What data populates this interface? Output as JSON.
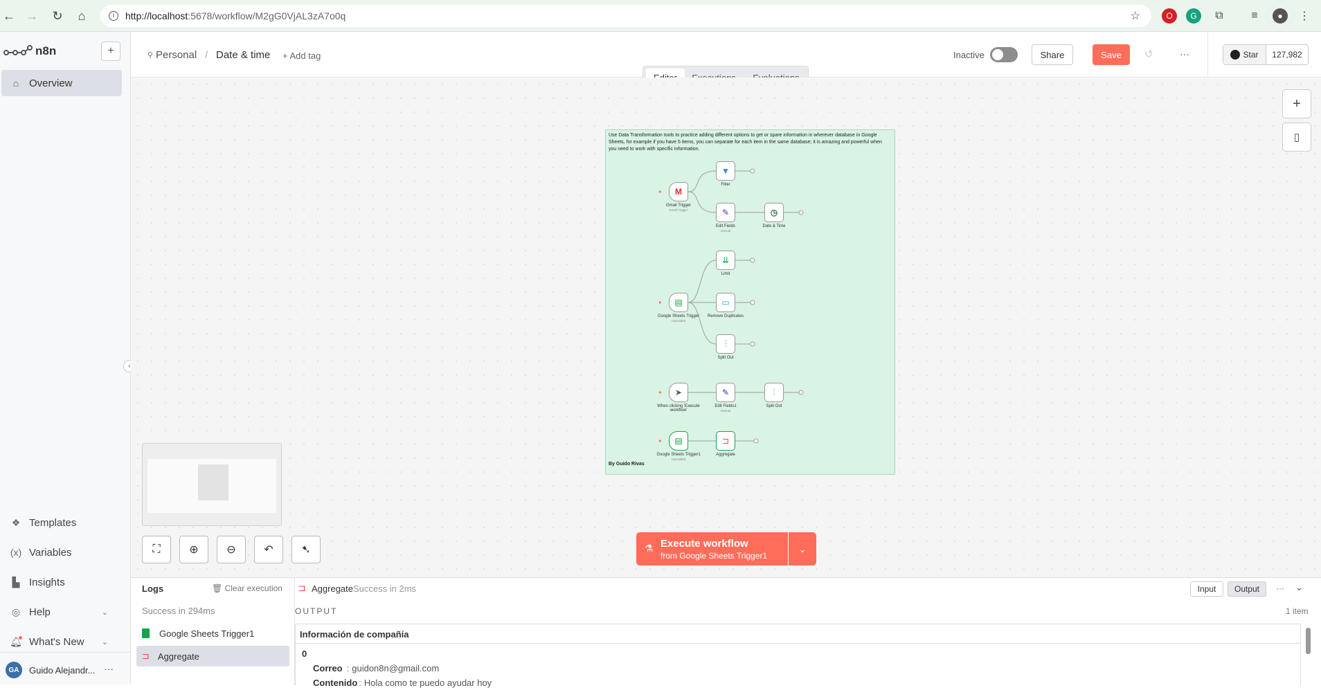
{
  "browser": {
    "url_host": "http://localhost",
    "url_path": ":5678/workflow/M2gG0VjAL3zA7o0q"
  },
  "sidebar": {
    "brand": "n8n",
    "items": [
      {
        "label": "Overview",
        "icon": "home-icon"
      },
      {
        "label": "Templates",
        "icon": "templates-icon"
      },
      {
        "label": "Variables",
        "icon": "variables-icon"
      },
      {
        "label": "Insights",
        "icon": "chart-icon"
      },
      {
        "label": "Help",
        "icon": "help-icon"
      },
      {
        "label": "What's New",
        "icon": "bell-icon"
      }
    ],
    "user_initials": "GA",
    "user_name": "Guido Alejandr...",
    "more": "···"
  },
  "header": {
    "project": "Personal",
    "separator": "/",
    "workflow_name": "Date & time",
    "add_tag": "+ Add tag",
    "status": "Inactive",
    "active": false,
    "share": "Share",
    "save": "Save",
    "more": "···",
    "github_star": "Star",
    "github_count": "127,982",
    "tabs": [
      "Editor",
      "Executions",
      "Evaluations"
    ],
    "active_tab": "Editor"
  },
  "canvas": {
    "sticky_text": "Use Data Transformation tools to practice adding different options to get or spare information in wherever database in Google Sheets, for example if you have 5 items, you can separate for each item in the same database; it is amazing and powerful when you need to work with specific information.",
    "sticky_author": "By Guido Rivas",
    "nodes": [
      {
        "id": "gmail",
        "label": "Gmail Trigger",
        "sub": "Email Trigger",
        "glyph": "M",
        "color": "#d93025"
      },
      {
        "id": "filter",
        "label": "Filter",
        "sub": "",
        "glyph": "▼",
        "color": "#3b82f6"
      },
      {
        "id": "editfields",
        "label": "Edit Fields",
        "sub": "manual",
        "glyph": "✎",
        "color": "#3b2fd6"
      },
      {
        "id": "datetime",
        "label": "Date & Time",
        "sub": "",
        "glyph": "◷",
        "color": "#1f7a3a"
      },
      {
        "id": "limit",
        "label": "Limit",
        "sub": "",
        "glyph": "⇊",
        "color": "#16a34a"
      },
      {
        "id": "sheets",
        "label": "Google Sheets Trigger",
        "sub": "rowAdded",
        "glyph": "▤",
        "color": "#16a34a"
      },
      {
        "id": "removedup",
        "label": "Remove Duplicates",
        "sub": "",
        "glyph": "▭",
        "color": "#0ea5e9"
      },
      {
        "id": "splitout",
        "label": "Split Out",
        "sub": "",
        "glyph": "⫶",
        "color": "#a855f7"
      },
      {
        "id": "manual",
        "label": "When clicking 'Execute workflow'",
        "sub": "",
        "glyph": "➤",
        "color": "#555"
      },
      {
        "id": "editfields1",
        "label": "Edit Fields1",
        "sub": "manual",
        "glyph": "✎",
        "color": "#3b2fd6"
      },
      {
        "id": "splitout2",
        "label": "Split Out",
        "sub": "",
        "glyph": "⫶",
        "color": "#a855f7"
      },
      {
        "id": "sheets1",
        "label": "Google Sheets Trigger1",
        "sub": "rowAdded",
        "glyph": "▤",
        "color": "#16a34a"
      },
      {
        "id": "aggregate",
        "label": "Aggregate",
        "sub": "",
        "glyph": "⊐",
        "color": "#ef4444"
      }
    ],
    "execute_title": "Execute workflow",
    "execute_sub": "from Google Sheets Trigger1"
  },
  "logs": {
    "title": "Logs",
    "clear": "Clear execution",
    "status": "Success in 294ms",
    "entries": [
      {
        "label": "Google Sheets Trigger1",
        "selected": false
      },
      {
        "label": "Aggregate",
        "selected": true
      }
    ],
    "detail_node": "Aggregate",
    "detail_status": "Success in 2ms",
    "input_tab": "Input",
    "output_tab": "Output",
    "more": "···",
    "output_label": "OUTPUT",
    "item_count": "1 item",
    "table_header": "Información de compañía",
    "row_index": "0",
    "fields": [
      {
        "key": "Correo",
        "value": "guidon8n@gmail.com"
      },
      {
        "key": "Contenido",
        "value": "Hola como te puedo ayudar hoy"
      }
    ]
  },
  "colors": {
    "accent": "#ff6d5a",
    "sticky_bg": "#d9f3e4",
    "sticky_border": "#a8d8b9",
    "chrome_bg": "#ebf5ed"
  }
}
